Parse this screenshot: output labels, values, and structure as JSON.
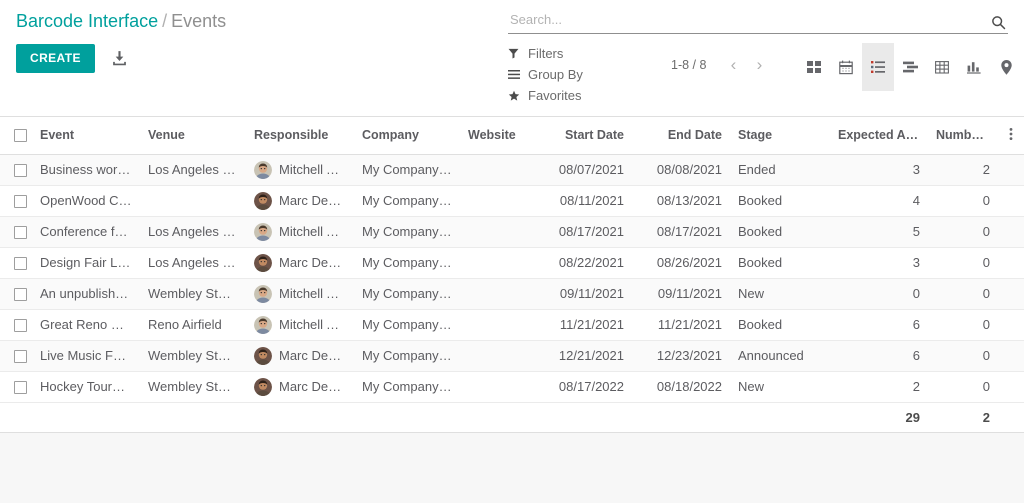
{
  "breadcrumb": {
    "parent": "Barcode Interface",
    "separator": "/",
    "current": "Events"
  },
  "toolbar": {
    "create_label": "CREATE",
    "import_icon": "import-icon"
  },
  "search": {
    "placeholder": "Search...",
    "value": "",
    "search_icon": "search-icon"
  },
  "filter_menu": {
    "filters_label": "Filters",
    "filters_icon": "filter-icon",
    "groupby_label": "Group By",
    "groupby_icon": "bars-icon",
    "favorites_label": "Favorites",
    "favorites_icon": "star-icon"
  },
  "pager": {
    "range": "1-8 / 8",
    "previous": "‹",
    "next": "›"
  },
  "view_switcher": {
    "active": "list",
    "views": [
      {
        "key": "kanban",
        "icon": "kanban-icon",
        "label": "Kanban"
      },
      {
        "key": "calendar",
        "icon": "calendar-icon",
        "label": "Calendar"
      },
      {
        "key": "list",
        "icon": "list-icon",
        "label": "List"
      },
      {
        "key": "gantt",
        "icon": "gantt-icon",
        "label": "Gantt"
      },
      {
        "key": "pivot",
        "icon": "pivot-icon",
        "label": "Pivot"
      },
      {
        "key": "graph",
        "icon": "graph-icon",
        "label": "Graph"
      },
      {
        "key": "map",
        "icon": "map-pin-icon",
        "label": "Map"
      }
    ]
  },
  "list": {
    "columns": [
      {
        "key": "event",
        "label": "Event",
        "align": "left"
      },
      {
        "key": "venue",
        "label": "Venue",
        "align": "left"
      },
      {
        "key": "responsible",
        "label": "Responsible",
        "align": "left"
      },
      {
        "key": "company",
        "label": "Company",
        "align": "left"
      },
      {
        "key": "website",
        "label": "Website",
        "align": "left"
      },
      {
        "key": "start_date",
        "label": "Start Date",
        "align": "right"
      },
      {
        "key": "end_date",
        "label": "End Date",
        "align": "right"
      },
      {
        "key": "stage",
        "label": "Stage",
        "align": "left"
      },
      {
        "key": "expected",
        "label": "Expected Atten…",
        "align": "right"
      },
      {
        "key": "registered",
        "label": "Number of P…",
        "align": "right"
      }
    ],
    "optional_columns_icon": "vertical-dots-icon",
    "rows": [
      {
        "event": "Business work…",
        "venue": "Los Angeles C…",
        "responsible": "Mitchell A…",
        "avatar": "mitchell-admin-avatar",
        "company": "My Company (…",
        "website": "",
        "start_date": "08/07/2021",
        "end_date": "08/08/2021",
        "stage": "Ended",
        "expected": "3",
        "registered": "2"
      },
      {
        "event": "OpenWood Coll…",
        "venue": "",
        "responsible": "Marc Demo",
        "avatar": "marc-demo-avatar",
        "company": "My Company (…",
        "website": "",
        "start_date": "08/11/2021",
        "end_date": "08/13/2021",
        "stage": "Booked",
        "expected": "4",
        "registered": "0"
      },
      {
        "event": "Conference for …",
        "venue": "Los Angeles C…",
        "responsible": "Mitchell A…",
        "avatar": "mitchell-admin-avatar",
        "company": "My Company (…",
        "website": "",
        "start_date": "08/17/2021",
        "end_date": "08/17/2021",
        "stage": "Booked",
        "expected": "5",
        "registered": "0"
      },
      {
        "event": "Design Fair Los…",
        "venue": "Los Angeles C…",
        "responsible": "Marc Demo",
        "avatar": "marc-demo-avatar",
        "company": "My Company (…",
        "website": "",
        "start_date": "08/22/2021",
        "end_date": "08/26/2021",
        "stage": "Booked",
        "expected": "3",
        "registered": "0"
      },
      {
        "event": "An unpublished…",
        "venue": "Wembley Stadi…",
        "responsible": "Mitchell A…",
        "avatar": "mitchell-admin-avatar",
        "company": "My Company (…",
        "website": "",
        "start_date": "09/11/2021",
        "end_date": "09/11/2021",
        "stage": "New",
        "expected": "0",
        "registered": "0"
      },
      {
        "event": "Great Reno Ball…",
        "venue": "Reno Airfield",
        "responsible": "Mitchell A…",
        "avatar": "mitchell-admin-avatar",
        "company": "My Company (…",
        "website": "",
        "start_date": "11/21/2021",
        "end_date": "11/21/2021",
        "stage": "Booked",
        "expected": "6",
        "registered": "0"
      },
      {
        "event": "Live Music Fest…",
        "venue": "Wembley Stadi…",
        "responsible": "Marc Demo",
        "avatar": "marc-demo-avatar",
        "company": "My Company (…",
        "website": "",
        "start_date": "12/21/2021",
        "end_date": "12/23/2021",
        "stage": "Announced",
        "expected": "6",
        "registered": "0"
      },
      {
        "event": "Hockey Tourna…",
        "venue": "Wembley Stadi…",
        "responsible": "Marc Demo",
        "avatar": "marc-demo-avatar",
        "company": "My Company (…",
        "website": "",
        "start_date": "08/17/2022",
        "end_date": "08/18/2022",
        "stage": "New",
        "expected": "2",
        "registered": "0"
      }
    ],
    "totals": {
      "expected": "29",
      "registered": "2"
    }
  },
  "colors": {
    "accent": "#00A09D",
    "breadcrumb_active": "#8f8f8f",
    "text": "#5c5c60",
    "row_stripe": "#FAFAFA",
    "page_bg": "#F7F7F7"
  }
}
